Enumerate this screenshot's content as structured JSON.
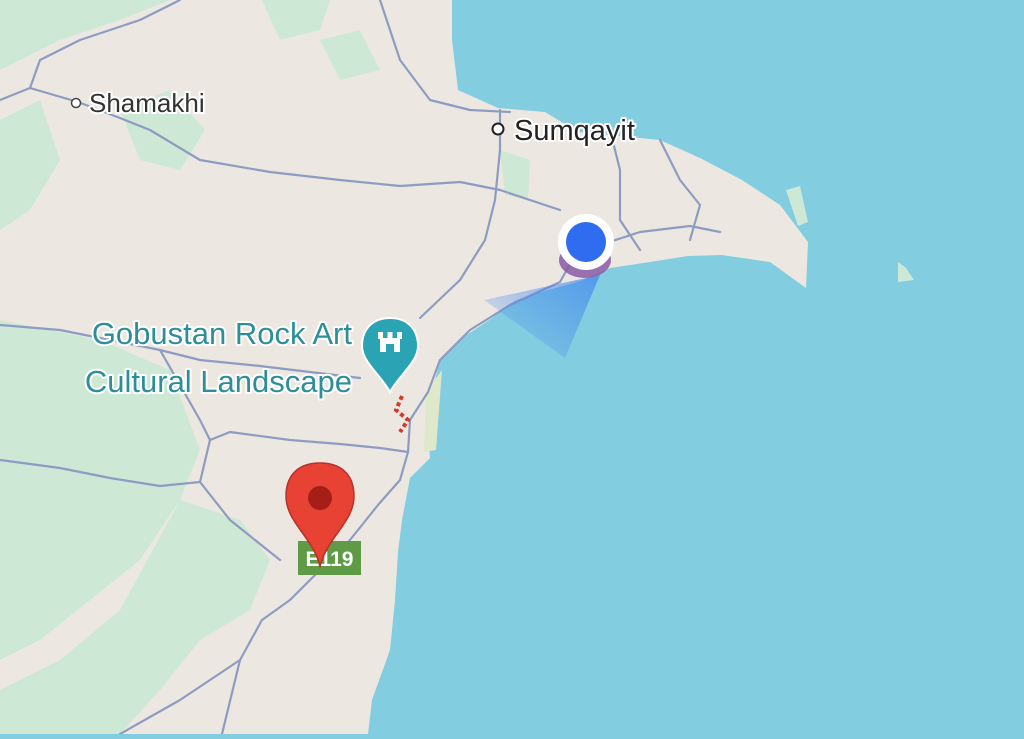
{
  "map": {
    "colors": {
      "water": "#82cde0",
      "land": "#ece8e1",
      "green": "#cde9d6",
      "road": "#8e9cc2",
      "poi": "#2aa4b4",
      "pin": "#e84234",
      "route_shield": "#5f9a44",
      "user_dot": "#2f6cf0"
    },
    "places": [
      {
        "id": "shamakhi",
        "label": "Shamakhi"
      },
      {
        "id": "sumqayit",
        "label": "Sumqayit"
      }
    ],
    "poi": {
      "line1": "Gobustan Rock Art",
      "line2": "Cultural Landscape",
      "icon": "castle-icon"
    },
    "route_shield": {
      "label": "E119"
    },
    "dropped_pin": {
      "icon": "red-pin-icon"
    },
    "user_location": {
      "icon": "blue-dot-icon"
    }
  }
}
